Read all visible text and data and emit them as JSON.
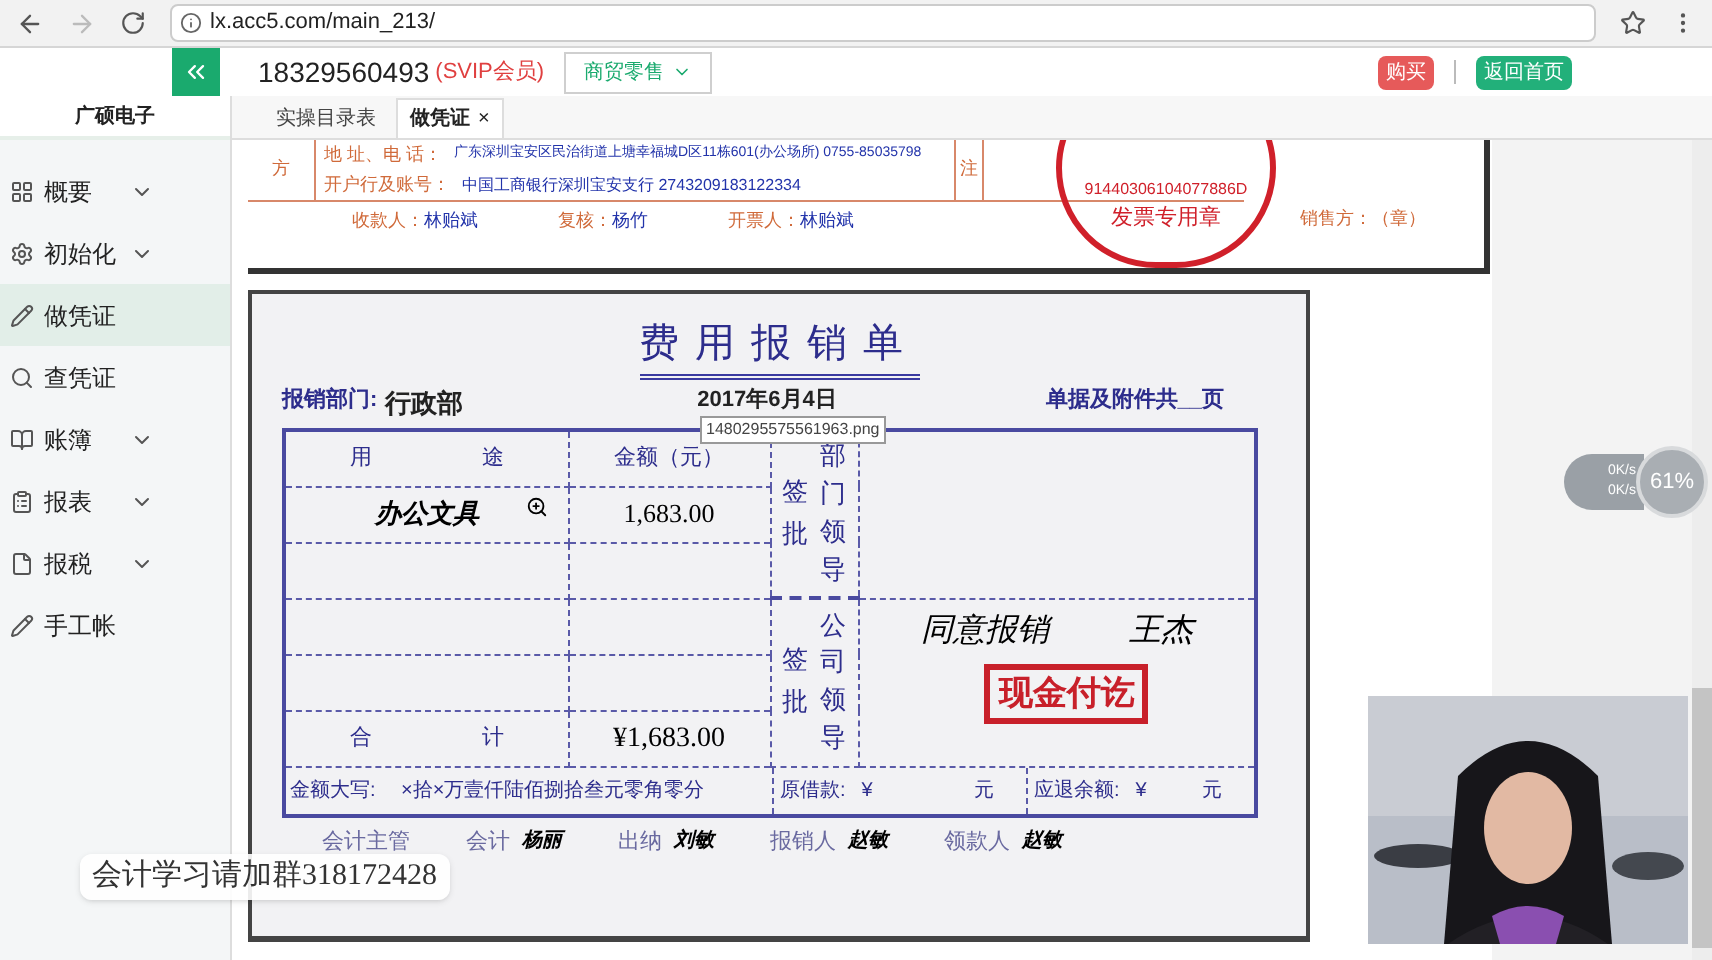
{
  "browser": {
    "url": "lx.acc5.com/main_213/"
  },
  "header": {
    "phone": "18329560493",
    "membership": "(SVIP会员)",
    "dropdown": "商贸零售",
    "buy": "购买",
    "home": "返回首页"
  },
  "sidebar": {
    "company": "广硕电子",
    "items": [
      {
        "label": "概要",
        "expandable": true,
        "selected": false
      },
      {
        "label": "初始化",
        "expandable": true,
        "selected": false
      },
      {
        "label": "做凭证",
        "expandable": false,
        "selected": true
      },
      {
        "label": "查凭证",
        "expandable": false,
        "selected": false
      },
      {
        "label": "账簿",
        "expandable": true,
        "selected": false
      },
      {
        "label": "报表",
        "expandable": true,
        "selected": false
      },
      {
        "label": "报税",
        "expandable": true,
        "selected": false
      },
      {
        "label": "手工帐",
        "expandable": false,
        "selected": false
      }
    ]
  },
  "tabs": [
    {
      "label": "实操目录表",
      "selected": false,
      "closable": false
    },
    {
      "label": "做凭证",
      "selected": true,
      "closable": true,
      "close": "×"
    }
  ],
  "invoice": {
    "side": "方",
    "address_label": "地 址、电 话：",
    "address": "广东深圳宝安区民治街道上塘幸福城D区11栋601(办公场所) 0755-85035798",
    "bank_label": "开户行及账号：",
    "bank": "中国工商银行深圳宝安支行 2743209183122334",
    "remarks": "注",
    "stamp_number": "91440306104077886D",
    "stamp_title": "发票专用章",
    "signers": [
      {
        "label": "收款人：",
        "name": "林贻斌"
      },
      {
        "label": "复核：",
        "name": "杨竹"
      },
      {
        "label": "开票人：",
        "name": "林贻斌"
      }
    ],
    "seller": "销售方：（章）"
  },
  "form": {
    "title": "费用报销单",
    "dept_label": "报销部门:",
    "dept": "行政部",
    "date": "2017年6月4日",
    "attachments": "单据及附件共__页",
    "col_use": "用　　　　　途",
    "col_amount": "金额（元）",
    "approve_dept": "签批",
    "approve_company": "签批",
    "dept_leader": "部门领导",
    "company_leader": "公司领导",
    "rows": [
      {
        "use": "办公文具",
        "amount": "1,683.00"
      },
      {
        "use": "",
        "amount": ""
      },
      {
        "use": "",
        "amount": ""
      },
      {
        "use": "",
        "amount": ""
      }
    ],
    "total_label": "合　　　　　计",
    "total": "¥1,683.00",
    "opinion": "同意报销",
    "approver": "王杰",
    "paid_stamp": "现金付讫",
    "amount_words": "金额大写:　 ×拾×万壹仟陆佰捌拾叁元零角零分",
    "borrowed_label": "原借款:",
    "borrowed_currency": "¥",
    "borrowed_unit": "元",
    "refund_label": "应退余额:",
    "refund_currency": "¥",
    "refund_unit": "元",
    "signatures": [
      {
        "label": "会计主管"
      },
      {
        "label": "会计",
        "name": "杨丽"
      },
      {
        "label": "出纳",
        "name": "刘敏"
      },
      {
        "label": "报销人",
        "name": "赵敏"
      },
      {
        "label": "领款人",
        "name": "赵敏"
      }
    ]
  },
  "tooltip": "1480295575561963.png",
  "speed_widget": {
    "upload": "0K/s",
    "download": "0K/s",
    "percent": "61%"
  },
  "overlay_text": "会计学习请加群318172428"
}
